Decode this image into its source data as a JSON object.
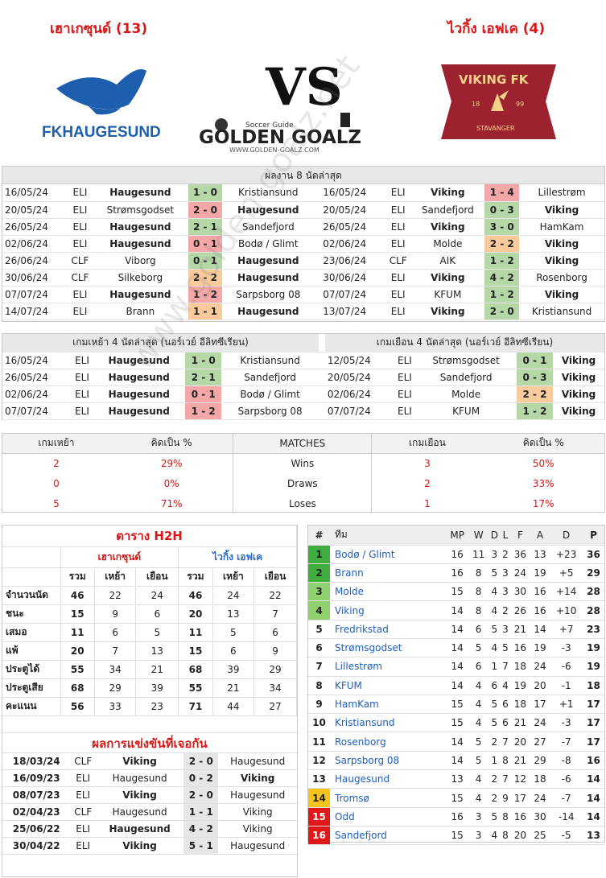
{
  "header": {
    "home_team": "เฮาเกซุนด์ (13)",
    "away_team": "ไวกิ้ง เอฟเค (4)",
    "home_logo_text": "FKHAUGESUND",
    "away_logo_text": "VIKING FK",
    "away_logo_sub": "STAVANGER",
    "away_logo_year_left": "18",
    "away_logo_year_right": "99",
    "vs_text": "VS",
    "site_text": "GOLDEN GOALZ",
    "site_sub": "Soccer Guide",
    "site_url": "WWW.GOLDEN-GOALZ.COM"
  },
  "last8": {
    "title": "ผลงาน 8 นัดล่าสุด",
    "home": [
      [
        "16/05/24",
        "ELI",
        "Haugesund",
        "1 - 0",
        "Kristiansund",
        "g",
        "home"
      ],
      [
        "20/05/24",
        "ELI",
        "Strømsgodset",
        "2 - 0",
        "Haugesund",
        "r",
        "away"
      ],
      [
        "26/05/24",
        "ELI",
        "Haugesund",
        "2 - 1",
        "Sandefjord",
        "g",
        "home"
      ],
      [
        "02/06/24",
        "ELI",
        "Haugesund",
        "0 - 1",
        "Bodø / Glimt",
        "r",
        "home"
      ],
      [
        "26/06/24",
        "CLF",
        "Viborg",
        "0 - 1",
        "Haugesund",
        "g",
        "away"
      ],
      [
        "30/06/24",
        "CLF",
        "Silkeborg",
        "2 - 2",
        "Haugesund",
        "o",
        "away"
      ],
      [
        "07/07/24",
        "ELI",
        "Haugesund",
        "1 - 2",
        "Sarpsborg 08",
        "r",
        "home"
      ],
      [
        "14/07/24",
        "ELI",
        "Brann",
        "1 - 1",
        "Haugesund",
        "o",
        "away"
      ]
    ],
    "away": [
      [
        "16/05/24",
        "ELI",
        "Viking",
        "1 - 4",
        "Lillestrøm",
        "r",
        "home"
      ],
      [
        "20/05/24",
        "ELI",
        "Sandefjord",
        "0 - 3",
        "Viking",
        "g",
        "away"
      ],
      [
        "26/05/24",
        "ELI",
        "Viking",
        "3 - 0",
        "HamKam",
        "g",
        "home"
      ],
      [
        "02/06/24",
        "ELI",
        "Molde",
        "2 - 2",
        "Viking",
        "o",
        "away"
      ],
      [
        "23/06/24",
        "CLF",
        "AIK",
        "1 - 2",
        "Viking",
        "g",
        "away"
      ],
      [
        "30/06/24",
        "ELI",
        "Viking",
        "4 - 2",
        "Rosenborg",
        "g",
        "home"
      ],
      [
        "07/07/24",
        "ELI",
        "KFUM",
        "1 - 2",
        "Viking",
        "g",
        "away"
      ],
      [
        "13/07/24",
        "ELI",
        "Viking",
        "2 - 0",
        "Kristiansund",
        "g",
        "home"
      ]
    ]
  },
  "last4": {
    "home_title": "เกมเหย้า 4 นัดล่าสุด (นอร์เวย์ อีลิทซีเรียน)",
    "away_title": "เกมเยือน 4 นัดล่าสุด (นอร์เวย์ อีลิทซีเรียน)",
    "home": [
      [
        "16/05/24",
        "ELI",
        "Haugesund",
        "1 - 0",
        "Kristiansund",
        "g",
        "home"
      ],
      [
        "26/05/24",
        "ELI",
        "Haugesund",
        "2 - 1",
        "Sandefjord",
        "g",
        "home"
      ],
      [
        "02/06/24",
        "ELI",
        "Haugesund",
        "0 - 1",
        "Bodø / Glimt",
        "r",
        "home"
      ],
      [
        "07/07/24",
        "ELI",
        "Haugesund",
        "1 - 2",
        "Sarpsborg 08",
        "r",
        "home"
      ]
    ],
    "away": [
      [
        "12/05/24",
        "ELI",
        "Strømsgodset",
        "0 - 1",
        "Viking",
        "g",
        "away"
      ],
      [
        "20/05/24",
        "ELI",
        "Sandefjord",
        "0 - 3",
        "Viking",
        "g",
        "away"
      ],
      [
        "02/06/24",
        "ELI",
        "Molde",
        "2 - 2",
        "Viking",
        "o",
        "away"
      ],
      [
        "07/07/24",
        "ELI",
        "KFUM",
        "1 - 2",
        "Viking",
        "g",
        "away"
      ]
    ]
  },
  "stats": {
    "headers": [
      "เกมเหย้า",
      "คิดเป็น %",
      "MATCHES",
      "เกมเยือน",
      "คิดเป็น %"
    ],
    "rows": [
      [
        "2",
        "29%",
        "Wins",
        "3",
        "50%"
      ],
      [
        "0",
        "0%",
        "Draws",
        "2",
        "33%"
      ],
      [
        "5",
        "71%",
        "Loses",
        "1",
        "17%"
      ]
    ]
  },
  "h2h": {
    "title": "ตาราง H2H",
    "home_team": "เฮาเกซุนด์",
    "away_team": "ไวกิ้ง เอฟเค",
    "cols": [
      "รวม",
      "เหย้า",
      "เยือน",
      "รวม",
      "เหย้า",
      "เยือน"
    ],
    "rows": [
      [
        "จำนวนนัด",
        "46",
        "22",
        "24",
        "46",
        "24",
        "22"
      ],
      [
        "ชนะ",
        "15",
        "9",
        "6",
        "20",
        "13",
        "7"
      ],
      [
        "เสมอ",
        "11",
        "6",
        "5",
        "11",
        "5",
        "6"
      ],
      [
        "แพ้",
        "20",
        "7",
        "13",
        "15",
        "6",
        "9"
      ],
      [
        "ประตูได้",
        "55",
        "34",
        "21",
        "68",
        "39",
        "29"
      ],
      [
        "ประตูเสีย",
        "68",
        "29",
        "39",
        "55",
        "21",
        "34"
      ],
      [
        "คะแนน",
        "56",
        "33",
        "23",
        "71",
        "44",
        "27"
      ]
    ]
  },
  "results": {
    "title": "ผลการแข่งขันที่เจอกัน",
    "rows": [
      [
        "18/03/24",
        "CLF",
        "Viking",
        "2 - 0",
        "Haugesund",
        "home"
      ],
      [
        "16/09/23",
        "ELI",
        "Haugesund",
        "0 - 2",
        "Viking",
        "away"
      ],
      [
        "08/07/23",
        "ELI",
        "Viking",
        "2 - 0",
        "Haugesund",
        "home"
      ],
      [
        "02/04/23",
        "CLF",
        "Haugesund",
        "1 - 1",
        "Viking",
        "none"
      ],
      [
        "25/06/22",
        "ELI",
        "Haugesund",
        "4 - 2",
        "Viking",
        "home"
      ],
      [
        "30/04/22",
        "ELI",
        "Viking",
        "5 - 1",
        "Haugesund",
        "home"
      ]
    ]
  },
  "league": {
    "headers": [
      "#",
      "ทีม",
      "MP",
      "W",
      "D",
      "L",
      "F",
      "A",
      "D",
      "P"
    ],
    "rows": [
      [
        "1",
        "Bodø / Glimt",
        "16",
        "11",
        "3",
        "2",
        "36",
        "13",
        "+23",
        "36",
        "g"
      ],
      [
        "2",
        "Brann",
        "16",
        "8",
        "5",
        "3",
        "24",
        "19",
        "+5",
        "29",
        "g"
      ],
      [
        "3",
        "Molde",
        "15",
        "8",
        "4",
        "3",
        "30",
        "16",
        "+14",
        "28",
        "lg"
      ],
      [
        "4",
        "Viking",
        "14",
        "8",
        "4",
        "2",
        "26",
        "16",
        "+10",
        "28",
        "lg"
      ],
      [
        "5",
        "Fredrikstad",
        "14",
        "6",
        "5",
        "3",
        "21",
        "14",
        "+7",
        "23",
        ""
      ],
      [
        "6",
        "Strømsgodset",
        "14",
        "5",
        "4",
        "5",
        "16",
        "19",
        "-3",
        "19",
        ""
      ],
      [
        "7",
        "Lillestrøm",
        "14",
        "6",
        "1",
        "7",
        "18",
        "24",
        "-6",
        "19",
        ""
      ],
      [
        "8",
        "KFUM",
        "14",
        "4",
        "6",
        "4",
        "19",
        "20",
        "-1",
        "18",
        ""
      ],
      [
        "9",
        "HamKam",
        "15",
        "4",
        "5",
        "6",
        "18",
        "17",
        "+1",
        "17",
        ""
      ],
      [
        "10",
        "Kristiansund",
        "15",
        "4",
        "5",
        "6",
        "21",
        "24",
        "-3",
        "17",
        ""
      ],
      [
        "11",
        "Rosenborg",
        "14",
        "5",
        "2",
        "7",
        "20",
        "27",
        "-7",
        "17",
        ""
      ],
      [
        "12",
        "Sarpsborg 08",
        "14",
        "5",
        "1",
        "8",
        "21",
        "29",
        "-8",
        "16",
        ""
      ],
      [
        "13",
        "Haugesund",
        "13",
        "4",
        "2",
        "7",
        "12",
        "18",
        "-6",
        "14",
        ""
      ],
      [
        "14",
        "Tromsø",
        "15",
        "4",
        "2",
        "9",
        "17",
        "24",
        "-7",
        "14",
        "y"
      ],
      [
        "15",
        "Odd",
        "16",
        "3",
        "5",
        "8",
        "16",
        "30",
        "-14",
        "14",
        "r"
      ],
      [
        "16",
        "Sandefjord",
        "15",
        "3",
        "4",
        "8",
        "20",
        "25",
        "-5",
        "13",
        "r"
      ]
    ]
  },
  "colors": {
    "title_red": "#d81818",
    "team_blue": "#1f5fbf",
    "win_green": "#b6d7a8",
    "loss_red": "#f4a7a7",
    "draw_orange": "#f9cb9c",
    "viking_maroon": "#9c2230",
    "haugesund_blue": "#1d5fae"
  }
}
